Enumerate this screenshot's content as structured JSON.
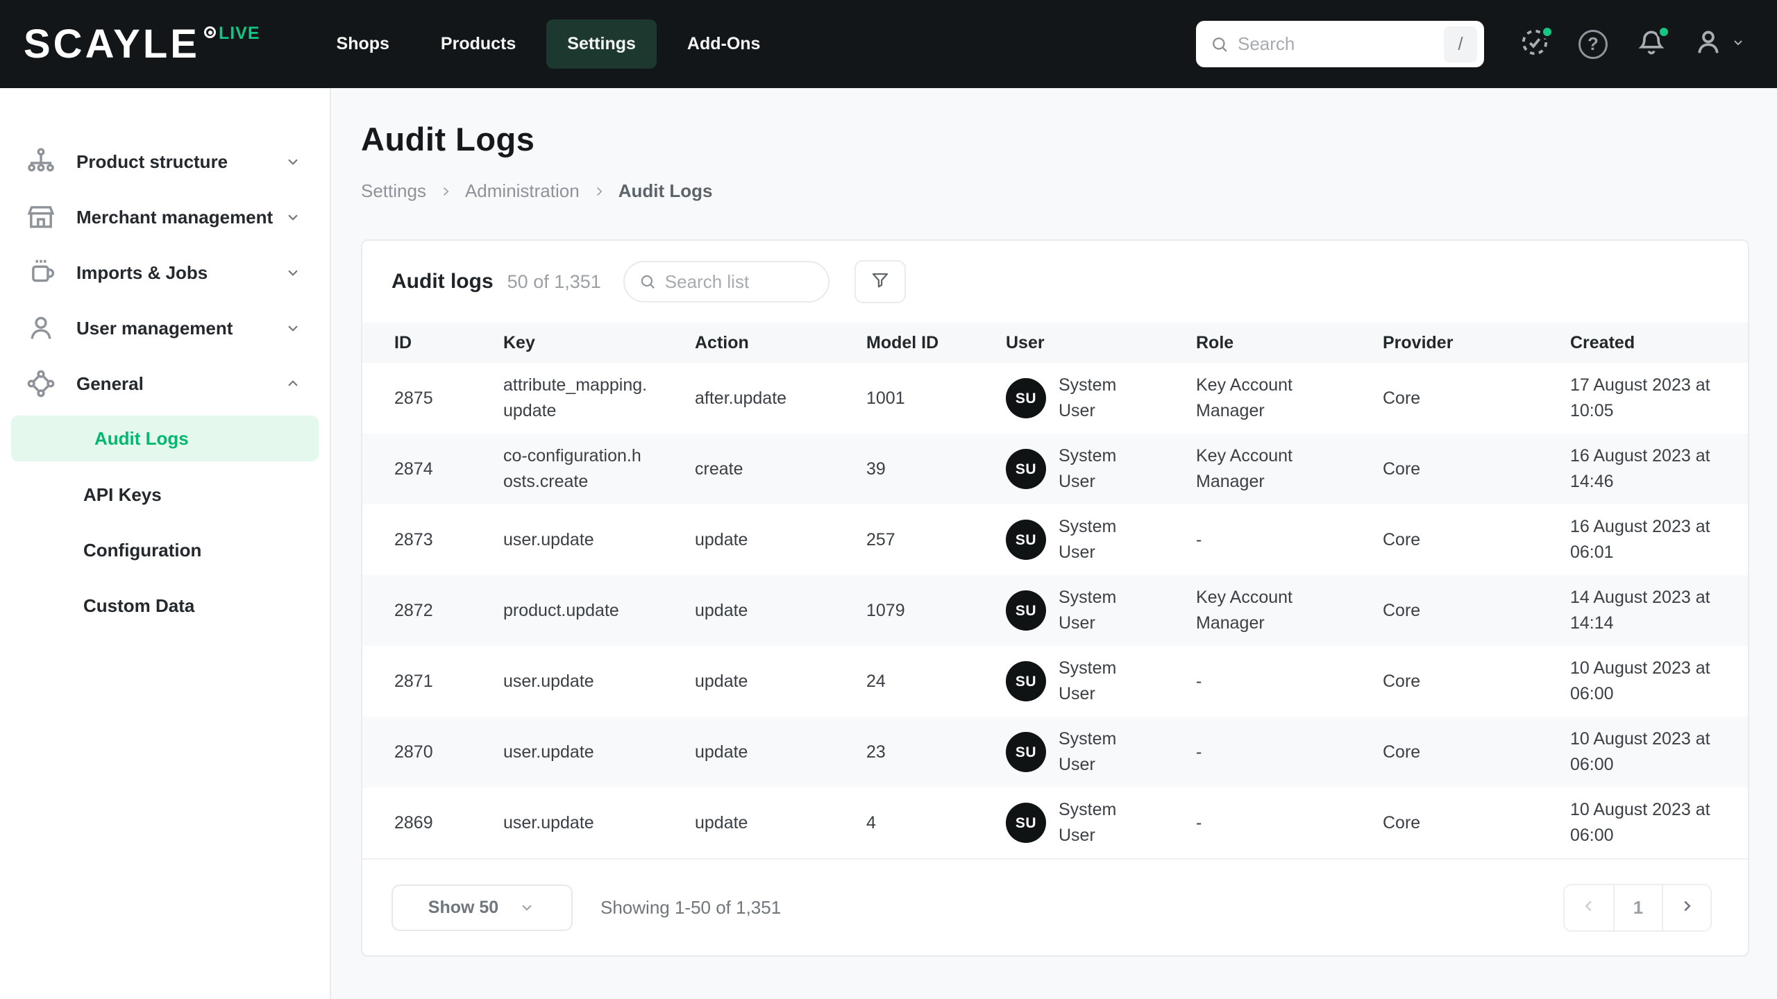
{
  "topbar": {
    "logo": "SCAYLE",
    "logo_badge": "LIVE",
    "nav": [
      {
        "label": "Shops",
        "active": false
      },
      {
        "label": "Products",
        "active": false
      },
      {
        "label": "Settings",
        "active": true
      },
      {
        "label": "Add-Ons",
        "active": false
      }
    ],
    "search": {
      "placeholder": "Search",
      "shortcut": "/"
    },
    "help_glyph": "?"
  },
  "sidebar": {
    "items": [
      {
        "label": "Product structure",
        "icon": "sitemap-icon",
        "state": "collapsed"
      },
      {
        "label": "Merchant management",
        "icon": "store-icon",
        "state": "collapsed"
      },
      {
        "label": "Imports & Jobs",
        "icon": "mug-icon",
        "state": "collapsed"
      },
      {
        "label": "User management",
        "icon": "user-icon",
        "state": "collapsed"
      },
      {
        "label": "General",
        "icon": "nodes-icon",
        "state": "expanded"
      }
    ],
    "sub_items": [
      {
        "label": "Audit Logs",
        "active": true
      },
      {
        "label": "API Keys",
        "active": false
      },
      {
        "label": "Configuration",
        "active": false
      },
      {
        "label": "Custom Data",
        "active": false
      }
    ]
  },
  "page": {
    "title": "Audit Logs",
    "breadcrumb": [
      "Settings",
      "Administration",
      "Audit Logs"
    ]
  },
  "card": {
    "title": "Audit logs",
    "count": "50 of 1,351",
    "search_placeholder": "Search list",
    "table": {
      "columns": [
        "ID",
        "Key",
        "Action",
        "Model ID",
        "User",
        "Role",
        "Provider",
        "Created"
      ],
      "rows": [
        {
          "id": "2875",
          "key": "attribute_mapping.update",
          "action": "after.update",
          "model_id": "1001",
          "user_initials": "SU",
          "user": "System User",
          "role": "Key Account Manager",
          "provider": "Core",
          "created": "17 August 2023 at 10:05"
        },
        {
          "id": "2874",
          "key": "co-configuration.hosts.create",
          "action": "create",
          "model_id": "39",
          "user_initials": "SU",
          "user": "System User",
          "role": "Key Account Manager",
          "provider": "Core",
          "created": "16 August 2023 at 14:46"
        },
        {
          "id": "2873",
          "key": "user.update",
          "action": "update",
          "model_id": "257",
          "user_initials": "SU",
          "user": "System User",
          "role": "-",
          "provider": "Core",
          "created": "16 August 2023 at 06:01"
        },
        {
          "id": "2872",
          "key": "product.update",
          "action": "update",
          "model_id": "1079",
          "user_initials": "SU",
          "user": "System User",
          "role": "Key Account Manager",
          "provider": "Core",
          "created": "14 August 2023 at 14:14"
        },
        {
          "id": "2871",
          "key": "user.update",
          "action": "update",
          "model_id": "24",
          "user_initials": "SU",
          "user": "System User",
          "role": "-",
          "provider": "Core",
          "created": "10 August 2023 at 06:00"
        },
        {
          "id": "2870",
          "key": "user.update",
          "action": "update",
          "model_id": "23",
          "user_initials": "SU",
          "user": "System User",
          "role": "-",
          "provider": "Core",
          "created": "10 August 2023 at 06:00"
        },
        {
          "id": "2869",
          "key": "user.update",
          "action": "update",
          "model_id": "4",
          "user_initials": "SU",
          "user": "System User",
          "role": "-",
          "provider": "Core",
          "created": "10 August 2023 at 06:00"
        }
      ]
    },
    "footer": {
      "page_size_label": "Show 50",
      "showing": "Showing 1-50 of 1,351",
      "pagination": {
        "current_page": "1"
      }
    }
  },
  "colors": {
    "topbar_bg": "#131619",
    "active_tab_bg": "#1d382e",
    "live_green": "#12c784",
    "accent_green": "#00b96e",
    "selected_item_bg": "#e4f8ee",
    "notification_dot": "#16c683",
    "zebra_row": "#f8f9fa",
    "avatar_bg": "#101314"
  }
}
